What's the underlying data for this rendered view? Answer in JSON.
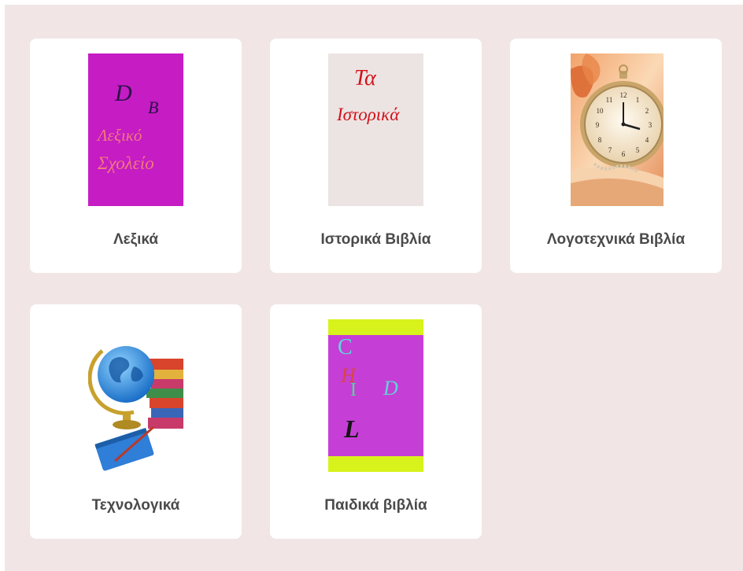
{
  "categories": [
    {
      "label": "Λεξικά",
      "cover": {
        "letters": [
          "D",
          "B"
        ],
        "line1": "Λεξικό",
        "line2": "Σχολείο",
        "bg": "#c51cc4"
      }
    },
    {
      "label": "Ιστορικά Βιβλία",
      "cover": {
        "line1": "Τα",
        "line2": "Ιστορικά",
        "bg": "#ece4e3"
      }
    },
    {
      "label": "Λογοτεχνικά Βιβλία",
      "cover": {
        "icon": "pocket-watch-icon",
        "bg": "#f0b48a"
      }
    },
    {
      "label": "Τεχνολογικά",
      "cover": {
        "icon": "globe-and-books-icon",
        "bg": "#ffffff"
      }
    },
    {
      "label": "Παιδικά βιβλία",
      "cover": {
        "letters": [
          "C",
          "H",
          "I",
          "D",
          "L"
        ],
        "bg": "#c53fd6",
        "band": "#d8f21c"
      }
    }
  ]
}
